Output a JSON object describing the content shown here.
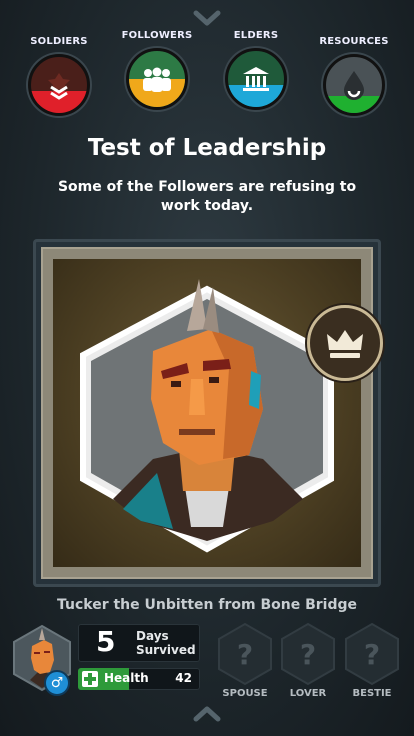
{
  "stats": [
    {
      "label": "SOLDIERS",
      "top_color": "#4a1f1a",
      "bottom_color": "#e0202a",
      "level": 0.4,
      "icon": "soldier-chevron-icon"
    },
    {
      "label": "FOLLOWERS",
      "top_color": "#2d7a45",
      "bottom_color": "#f0a81a",
      "level": 0.5,
      "icon": "followers-icon"
    },
    {
      "label": "ELDERS",
      "top_color": "#1f5a3a",
      "bottom_color": "#1ea8d8",
      "level": 0.4,
      "icon": "elders-temple-icon"
    },
    {
      "label": "RESOURCES",
      "top_color": "#4a5256",
      "bottom_color": "#1fb030",
      "level": 0.3,
      "icon": "resources-drop-icon"
    }
  ],
  "event": {
    "title": "Test of Leadership",
    "description": "Some of the Followers are refusing to work today."
  },
  "character": {
    "name": "Tucker the Unbitten from Bone Bridge",
    "days_value": "5",
    "days_label_1": "Days",
    "days_label_2": "Survived",
    "health_label": "Health",
    "health_value": "42",
    "health_fraction": 0.42,
    "gender_symbol": "♂"
  },
  "relations": [
    {
      "label": "SPOUSE",
      "icon": "?"
    },
    {
      "label": "LOVER",
      "icon": "?"
    },
    {
      "label": "BESTIE",
      "icon": "?"
    }
  ],
  "colors": {
    "accent_gold": "#c9b995",
    "health_green": "#2e9a3a"
  }
}
